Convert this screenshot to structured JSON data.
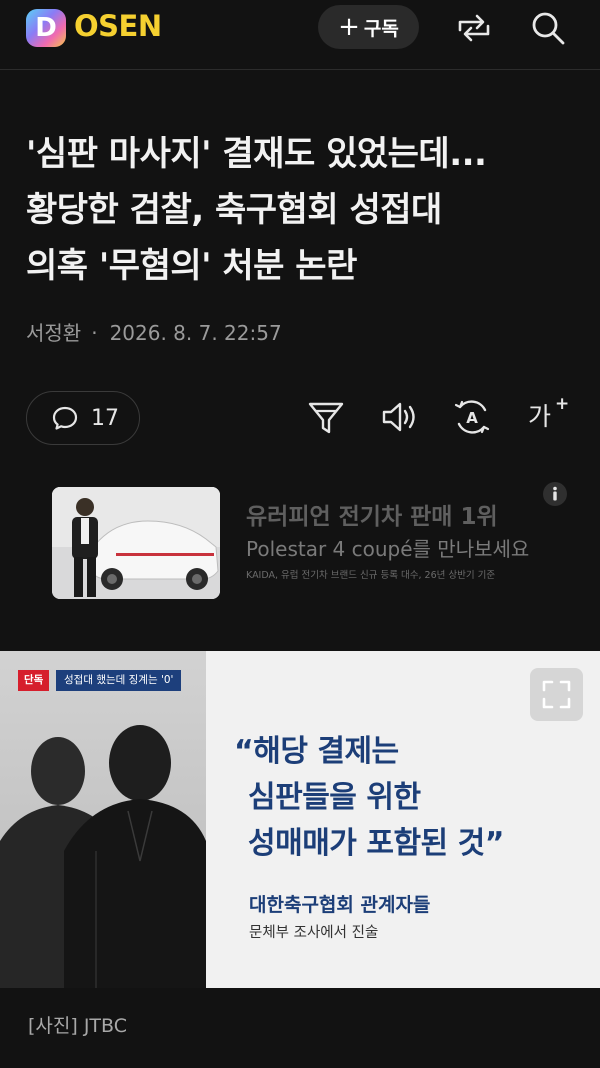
{
  "header": {
    "logo_letter": "D",
    "logo_text": "OSEN",
    "subscribe_plus": "+",
    "subscribe_label": "구독",
    "share_icon": "share-icon",
    "search_icon": "search-icon"
  },
  "article": {
    "title_lines": [
      "'심판 마사지' 결재도 있었는데...",
      "황당한 검찰, 축구협회 성접대",
      "의혹 '무혐의' 처분 논란"
    ],
    "author": "서정환",
    "separator": "·",
    "datetime": "2026. 8. 7. 22:57"
  },
  "toolbar": {
    "comment_icon": "comment-bubble-icon",
    "comment_count": "17",
    "filter_icon": "filter-icon",
    "sound_icon": "speaker-icon",
    "auto_icon": "auto-translate-icon",
    "font_label": "가",
    "font_plus": "+"
  },
  "ad": {
    "title": "유러피언 전기차 판매 1위",
    "subtitle": "Polestar 4 coupé를 만나보세요",
    "note": "KAIDA, 유럽 전기차 브랜드 신규 등록 대수, 26년 상반기 기준",
    "info_icon": "info-icon"
  },
  "photo": {
    "tag_exclusive": "단독",
    "tag_headline": "성접대 했는데 징계는 '0'",
    "quote_lines": [
      "“해당 결제는",
      "심판들을 위한",
      "성매매가 포함된 것”"
    ],
    "source": "대한축구협회 관계자들",
    "source_sub": "문체부 조사에서 진술",
    "expand_icon": "expand-icon"
  },
  "caption": "[사진] JTBC",
  "colors": {
    "background": "#121212",
    "logo_yellow": "#f5d030",
    "quote_navy": "#1c3e78",
    "tag_red": "#d61e2c"
  }
}
